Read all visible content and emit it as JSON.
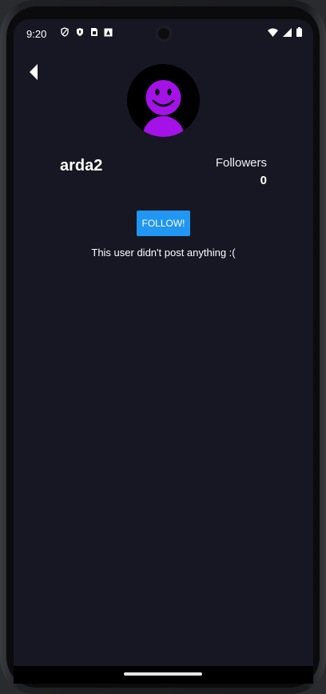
{
  "status_bar": {
    "time": "9:20",
    "left_icons": [
      "shield-icon",
      "security-icon",
      "sim-card-icon",
      "app-notification-icon"
    ],
    "right_icons": [
      "wifi-icon",
      "signal-icon",
      "battery-icon"
    ]
  },
  "profile": {
    "username": "arda2",
    "followers_label": "Followers",
    "followers_count": "0",
    "avatar_icon": "smiley-avatar-icon",
    "avatar_color": "#a412e8"
  },
  "actions": {
    "follow_label": "FOLLOW!",
    "follow_color": "#2196f3"
  },
  "posts": {
    "empty_message": "This user didn't post anything :("
  },
  "theme": {
    "background": "#161722"
  }
}
